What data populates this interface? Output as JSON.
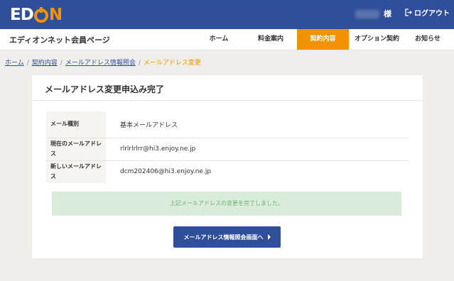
{
  "header": {
    "logo_text": "EDION",
    "user_suffix": "様",
    "logout_label": "ログアウト"
  },
  "nav": {
    "site_title": "エディオンネット会員ページ",
    "items": [
      {
        "label": "ホーム"
      },
      {
        "label": "料金案内"
      },
      {
        "label": "契約内容"
      },
      {
        "label": "オプション契約"
      },
      {
        "label": "お知らせ"
      }
    ]
  },
  "breadcrumb": {
    "items": [
      "ホーム",
      "契約内容",
      "メールアドレス情報照会"
    ],
    "current": "メールアドレス変更"
  },
  "card": {
    "title": "メールアドレス変更申込み完了",
    "rows": [
      {
        "label": "メール種別",
        "value": "基本メールアドレス"
      },
      {
        "label": "現在のメールアドレス",
        "value": "rlrlrlrlrr@hi3.enjoy.ne.jp"
      },
      {
        "label": "新しいメールアドレス",
        "value": "dcm202406@hi3.enjoy.ne.jp"
      }
    ],
    "notice": "上記メールアドレスの変更を完了しました。",
    "button_label": "メールアドレス情報照会画面へ"
  },
  "colors": {
    "header_bg": "#2f4f9a",
    "accent": "#f39200",
    "notice_bg": "#d8ecd9",
    "notice_text": "#6fae77"
  }
}
